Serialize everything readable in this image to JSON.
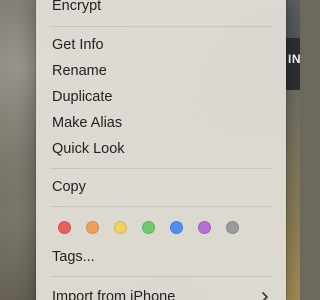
{
  "desktop": {
    "window_label": "IN"
  },
  "menu": {
    "items": [
      {
        "label": "Encrypt"
      },
      {
        "label": "Get Info"
      },
      {
        "label": "Rename"
      },
      {
        "label": "Duplicate"
      },
      {
        "label": "Make Alias"
      },
      {
        "label": "Quick Look"
      },
      {
        "label": "Copy"
      },
      {
        "label": "Tags..."
      },
      {
        "label": "Import from iPhone"
      }
    ],
    "submenu_icon": "chevron-right-icon",
    "tag_colors": [
      {
        "name": "red",
        "hex": "#ec5f58"
      },
      {
        "name": "orange",
        "hex": "#f0a05a"
      },
      {
        "name": "yellow",
        "hex": "#f2d161"
      },
      {
        "name": "green",
        "hex": "#6ccb6a"
      },
      {
        "name": "blue",
        "hex": "#4f8ef7"
      },
      {
        "name": "purple",
        "hex": "#b36fd6"
      },
      {
        "name": "gray",
        "hex": "#9b9b9b"
      }
    ]
  }
}
